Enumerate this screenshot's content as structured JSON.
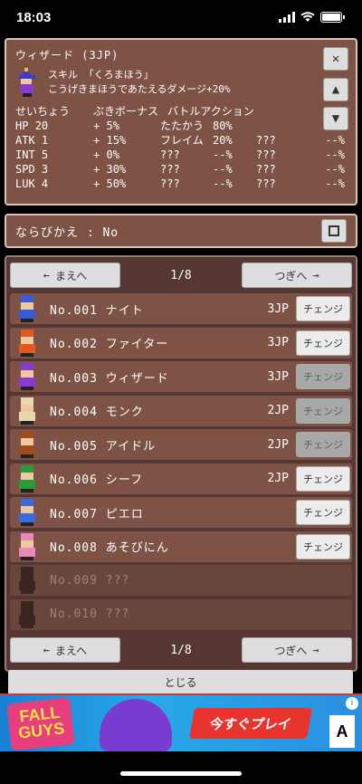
{
  "status": {
    "time": "18:03"
  },
  "info": {
    "title": "ウィザード (3JP)",
    "skill_line1": "スキル 「くろまほう」",
    "skill_line2": "こうげきまほうであたえるダメージ+20%",
    "headers": [
      "せいちょう",
      "ぶきボーナス",
      "バトルアクション"
    ],
    "stats": [
      {
        "stat": "HP",
        "val": "20",
        "weapon": "+",
        "wb": "5%",
        "act1": "たたかう",
        "p1": "80%",
        "act2": "",
        "p2": ""
      },
      {
        "stat": "ATK",
        "val": "1",
        "weapon": "+",
        "wb": "15%",
        "act1": "フレイム",
        "p1": "20%",
        "act2": "???",
        "p2": "--%"
      },
      {
        "stat": "INT",
        "val": "5",
        "weapon": "+",
        "wb": "0%",
        "act1": "???",
        "p1": "--%",
        "act2": "???",
        "p2": "--%"
      },
      {
        "stat": "SPD",
        "val": "3",
        "weapon": "+",
        "wb": "30%",
        "act1": "???",
        "p1": "--%",
        "act2": "???",
        "p2": "--%"
      },
      {
        "stat": "LUK",
        "val": "4",
        "weapon": "+",
        "wb": "50%",
        "act1": "???",
        "p1": "--%",
        "act2": "???",
        "p2": "--%"
      }
    ]
  },
  "sort": {
    "label": "ならびかえ : No"
  },
  "pager": {
    "prev": "まえへ",
    "next": "つぎへ",
    "page": "1/8"
  },
  "rows": [
    {
      "name": "No.001 ナイト",
      "jp": "3JP",
      "btn": "チェンジ",
      "enabled": true,
      "locked": false,
      "color": "#3a5ad8"
    },
    {
      "name": "No.002 ファイター",
      "jp": "3JP",
      "btn": "チェンジ",
      "enabled": true,
      "locked": false,
      "color": "#e05a20"
    },
    {
      "name": "No.003 ウィザード",
      "jp": "3JP",
      "btn": "チェンジ",
      "enabled": false,
      "locked": false,
      "color": "#8a3ad0"
    },
    {
      "name": "No.004 モンク",
      "jp": "2JP",
      "btn": "チェンジ",
      "enabled": false,
      "locked": false,
      "color": "#e8d8b0"
    },
    {
      "name": "No.005 アイドル",
      "jp": "2JP",
      "btn": "チェンジ",
      "enabled": false,
      "locked": false,
      "color": "#a04a20"
    },
    {
      "name": "No.006 シーフ",
      "jp": "2JP",
      "btn": "チェンジ",
      "enabled": true,
      "locked": false,
      "color": "#2a9a3a"
    },
    {
      "name": "No.007 ピエロ",
      "jp": "",
      "btn": "チェンジ",
      "enabled": true,
      "locked": false,
      "color": "#3a6ae0"
    },
    {
      "name": "No.008 あそびにん",
      "jp": "",
      "btn": "チェンジ",
      "enabled": true,
      "locked": false,
      "color": "#e888b8"
    },
    {
      "name": "No.009 ???",
      "jp": "",
      "btn": "",
      "enabled": false,
      "locked": true,
      "color": "#3a2620"
    },
    {
      "name": "No.010 ???",
      "jp": "",
      "btn": "",
      "enabled": false,
      "locked": true,
      "color": "#3a2620"
    }
  ],
  "close_label": "とじる",
  "ad": {
    "logo": "FALL GUYS",
    "cta": "今すぐプレイ",
    "rating": "A"
  }
}
